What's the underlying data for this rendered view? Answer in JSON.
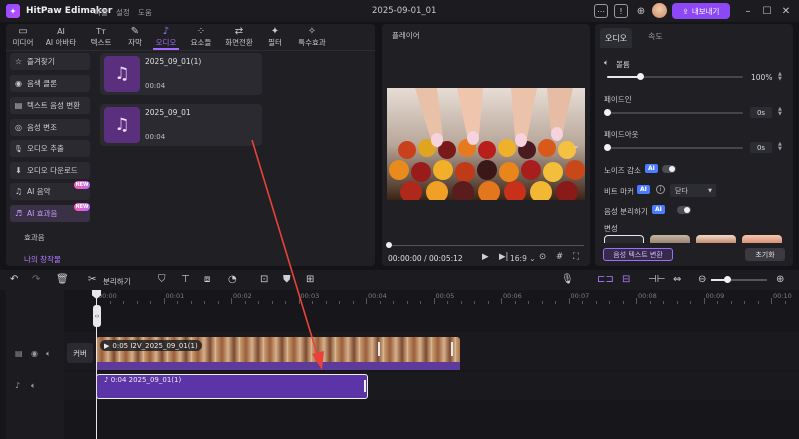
{
  "titlebar": {
    "app_name": "HitPaw Edimakor",
    "menu": [
      "파일",
      "설정",
      "도움"
    ],
    "doc_title": "2025-09-01_01",
    "export_label": "내보내기",
    "icons": [
      "chat-icon",
      "ai-icon",
      "message-icon",
      "download-icon",
      "avatar"
    ]
  },
  "categories": [
    {
      "icon": "▭",
      "label": "미디어"
    },
    {
      "icon": "AI",
      "label": "AI 아바타"
    },
    {
      "icon": "Tт",
      "label": "텍스트"
    },
    {
      "icon": "✎",
      "label": "자막"
    },
    {
      "icon": "♪",
      "label": "오디오"
    },
    {
      "icon": "⁘",
      "label": "요소들"
    },
    {
      "icon": "⇄",
      "label": "화면전환"
    },
    {
      "icon": "✦",
      "label": "필터"
    },
    {
      "icon": "✧",
      "label": "특수효과"
    }
  ],
  "sidebar": {
    "items": [
      {
        "icon": "☆",
        "label": "즐겨찾기"
      },
      {
        "icon": "◉",
        "label": "음색 클론"
      },
      {
        "icon": "▤",
        "label": "텍스트 음성 변환"
      },
      {
        "icon": "◎",
        "label": "음성 변조"
      },
      {
        "icon": "🎙",
        "label": "오디오 추출"
      },
      {
        "icon": "⬇",
        "label": "오디오 다운로드"
      },
      {
        "icon": "♫",
        "label": "AI 음악"
      },
      {
        "icon": "♬",
        "label": "AI 효과음"
      }
    ],
    "new_badge": "NEW",
    "sub_items": [
      "효과음",
      "나의 창작물"
    ]
  },
  "media": [
    {
      "name": "2025_09_01(1)",
      "duration": "00:04"
    },
    {
      "name": "2025_09_01",
      "duration": "00:04"
    }
  ],
  "player": {
    "label": "플레이어",
    "timecode": "00:00:00 / 00:05:12",
    "ratio": "16:9"
  },
  "right_panel": {
    "tabs": [
      "오디오",
      "속도"
    ],
    "volume": {
      "label": "볼륨",
      "value": "100%",
      "level_percent": 100
    },
    "fade_in": {
      "label": "페이드인",
      "value": "0s"
    },
    "fade_out": {
      "label": "페이드아웃",
      "value": "0s"
    },
    "noise": {
      "label": "노이즈 감소",
      "ai": "AI"
    },
    "beat": {
      "label": "비트 마커",
      "ai": "AI",
      "select_value": "닫다"
    },
    "vocal": {
      "label": "음성 분리하기",
      "ai": "AI"
    },
    "voice_change": {
      "label": "변성",
      "convert_label": "음성 텍스트 변환",
      "reset_label": "초기화"
    }
  },
  "timeline": {
    "split_label": "분리하기",
    "ticks": [
      "00:00",
      "00:01",
      "00:02",
      "00:03",
      "00:04",
      "00:05",
      "00:06",
      "00:07",
      "00:08",
      "00:09",
      "00:10"
    ],
    "cover_label": "커버",
    "video_clip_label": "0:05 I2V_2025_09_01(1)",
    "audio_clip_label": "0:04 2025_09_01(1)"
  }
}
